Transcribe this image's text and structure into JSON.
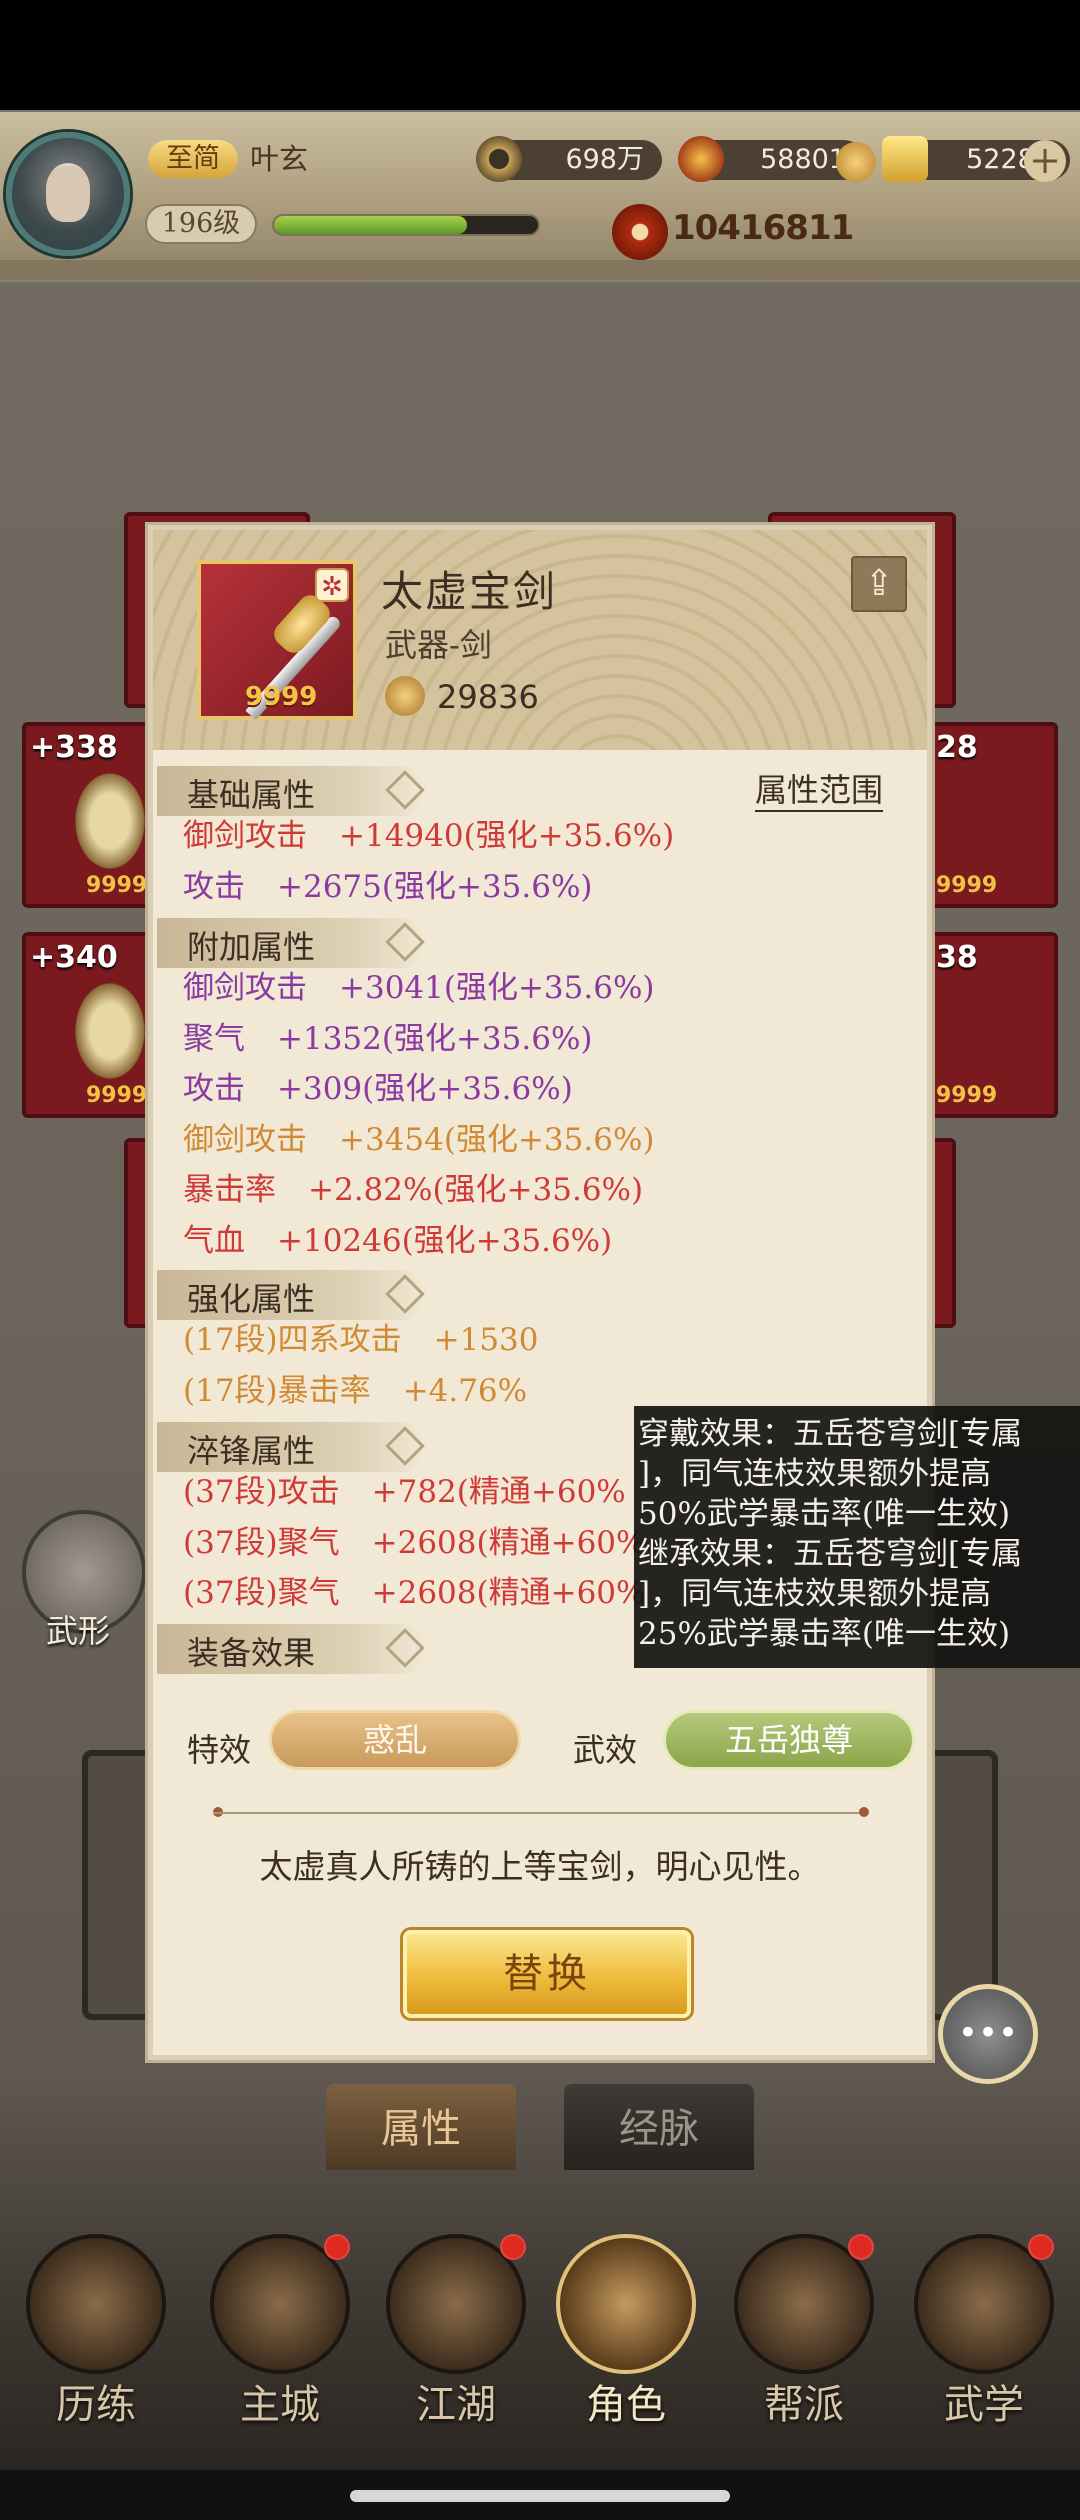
{
  "player": {
    "rank": "至简",
    "name": "叶玄",
    "level": "196级",
    "exp_fraction": 0.73,
    "power": "10416811"
  },
  "resources": {
    "copper": "698万",
    "gems": "58801",
    "gold": "52282"
  },
  "background_slots": [
    "+338",
    "+340",
    "28",
    "38"
  ],
  "slot_quantity": "9999",
  "item": {
    "name": "太虚宝剑",
    "type": "武器-剑",
    "score": "29836",
    "quantity": "9999"
  },
  "attributes": {
    "range_link": "属性范围",
    "base_title": "基础属性",
    "base": [
      {
        "name": "御剑攻击",
        "value": "+14940(强化+35.6%)",
        "color": "#d03a36"
      },
      {
        "name": "攻击",
        "value": "+2675(强化+35.6%)",
        "color": "#8a3aa0"
      }
    ],
    "extra_title": "附加属性",
    "extra": [
      {
        "name": "御剑攻击",
        "value": "+3041(强化+35.6%)",
        "color": "#8a3aa0"
      },
      {
        "name": "聚气",
        "value": "+1352(强化+35.6%)",
        "color": "#8a3aa0"
      },
      {
        "name": "攻击",
        "value": "+309(强化+35.6%)",
        "color": "#8a3aa0"
      },
      {
        "name": "御剑攻击",
        "value": "+3454(强化+35.6%)",
        "color": "#d18a33"
      },
      {
        "name": "暴击率",
        "value": "+2.82%(强化+35.6%)",
        "color": "#d03a36"
      },
      {
        "name": "气血",
        "value": "+10246(强化+35.6%)",
        "color": "#d03a36"
      }
    ],
    "enhance_title": "强化属性",
    "enhance": [
      {
        "name": "(17段)四系攻击",
        "value": "+1530",
        "color": "#d18a33"
      },
      {
        "name": "(17段)暴击率",
        "value": "+4.76%",
        "color": "#d18a33"
      }
    ],
    "temper_title": "淬锋属性",
    "temper": [
      {
        "name": "(37段)攻击",
        "value": "+782(精通+60%",
        "color": "#d03a36"
      },
      {
        "name": "(37段)聚气",
        "value": "+2608(精通+60%",
        "color": "#d03a36"
      },
      {
        "name": "(37段)聚气",
        "value": "+2608(精通+60%",
        "color": "#d03a36"
      }
    ],
    "effect_title": "装备效果"
  },
  "effects": {
    "special_label": "特效",
    "special_value": "惑乱",
    "wu_label": "武效",
    "wu_value": "五岳独尊"
  },
  "description": "太虚真人所铸的上等宝剑，明心见性。",
  "swap_label": "替换",
  "tooltip_lines": [
    "穿戴效果：五岳苍穹剑[专属",
    "]，同气连枝效果额外提高",
    "50%武学暴击率(唯一生效)",
    "继承效果：五岳苍穹剑[专属",
    "]，同气连枝效果额外提高",
    "25%武学暴击率(唯一生效)"
  ],
  "side_label": "武形",
  "tabs": [
    "属性",
    "经脉"
  ],
  "nav": [
    "历练",
    "主城",
    "江湖",
    "角色",
    "帮派",
    "武学"
  ]
}
